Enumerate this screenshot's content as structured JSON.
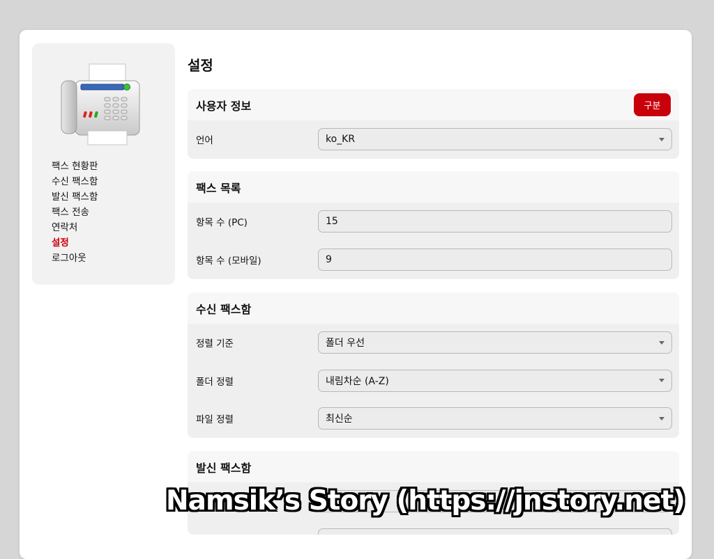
{
  "sidebar": {
    "logo_icon": "fax-machine-icon",
    "items": [
      {
        "label": "팩스 현황판"
      },
      {
        "label": "수신 팩스함"
      },
      {
        "label": "발신 팩스함"
      },
      {
        "label": "팩스 전송"
      },
      {
        "label": "연락처"
      },
      {
        "label": "설정"
      },
      {
        "label": "로그아웃"
      }
    ],
    "active_index": 5
  },
  "main": {
    "title": "설정",
    "sections": [
      {
        "title": "사용자 정보",
        "button_label": "구분",
        "rows": [
          {
            "label": "언어",
            "type": "select",
            "value": "ko_KR"
          }
        ]
      },
      {
        "title": "팩스 목록",
        "rows": [
          {
            "label": "항목 수 (PC)",
            "type": "input",
            "value": "15"
          },
          {
            "label": "항목 수 (모바일)",
            "type": "input",
            "value": "9"
          }
        ]
      },
      {
        "title": "수신 팩스함",
        "rows": [
          {
            "label": "정렬 기준",
            "type": "select",
            "value": "폴더 우선"
          },
          {
            "label": "폴더 정렬",
            "type": "select",
            "value": "내림차순 (A-Z)"
          },
          {
            "label": "파일 정렬",
            "type": "select",
            "value": "최신순"
          }
        ]
      },
      {
        "title": "발신 팩스함"
      }
    ]
  },
  "watermark": "Namsik’s Story (https://jnstory.net)",
  "colors": {
    "accent": "#c8000a",
    "background": "#d6d6d6",
    "panel": "#f2f2f2"
  }
}
